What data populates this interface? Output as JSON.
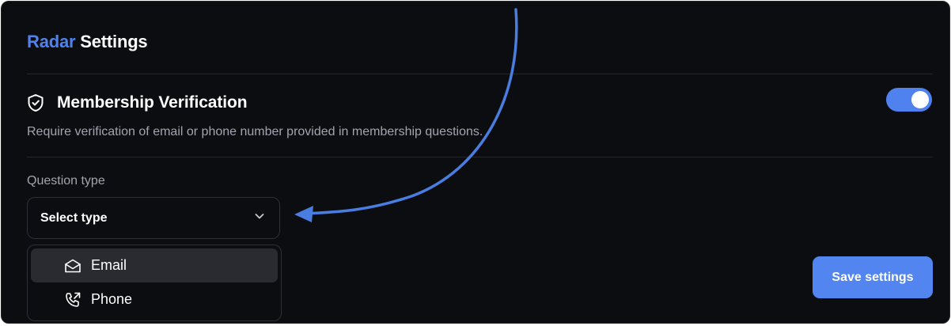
{
  "header": {
    "title_accent": "Radar",
    "title_rest": "Settings"
  },
  "membership": {
    "title": "Membership Verification",
    "description": "Require verification of email or phone number provided in membership questions.",
    "enabled": true,
    "icon": "shield-check-icon"
  },
  "question_type": {
    "label": "Question type",
    "selected": "Select type",
    "options": [
      {
        "label": "Email",
        "icon": "envelope-open-icon",
        "highlighted": true
      },
      {
        "label": "Phone",
        "icon": "phone-outgoing-icon",
        "highlighted": false
      }
    ]
  },
  "actions": {
    "save_label": "Save settings"
  },
  "colors": {
    "accent": "#4f82ee",
    "background": "#0c0d11",
    "muted_text": "#a2a5ad",
    "annotation_arrow": "#4a7de0"
  }
}
